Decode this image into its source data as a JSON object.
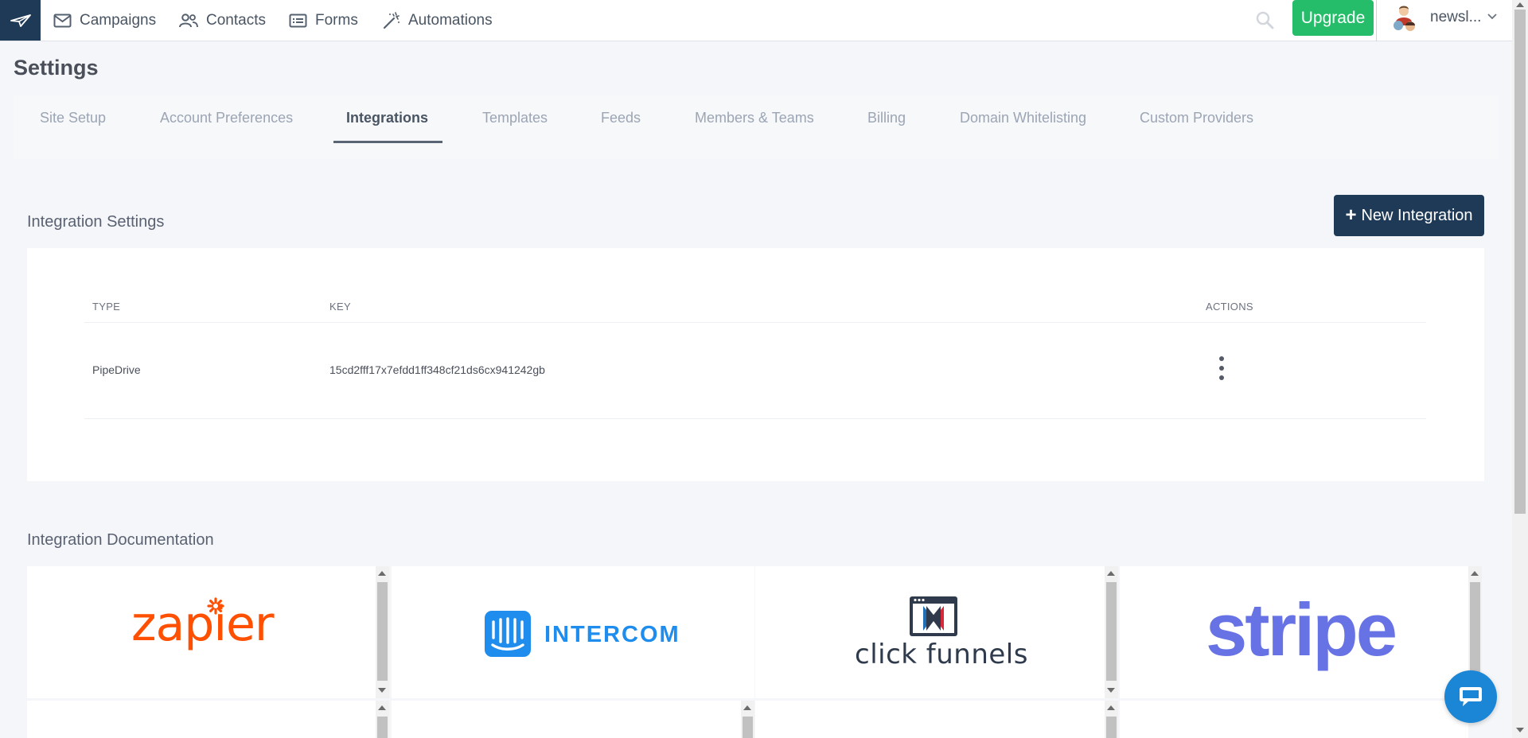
{
  "nav": {
    "items": [
      {
        "label": "Campaigns",
        "icon": "envelope-icon"
      },
      {
        "label": "Contacts",
        "icon": "users-icon"
      },
      {
        "label": "Forms",
        "icon": "form-icon"
      },
      {
        "label": "Automations",
        "icon": "magic-wand-icon"
      }
    ],
    "upgrade_label": "Upgrade",
    "user_name": "newsl...",
    "brand_icon": "paper-plane-icon"
  },
  "page": {
    "title": "Settings"
  },
  "tabs": [
    {
      "label": "Site Setup",
      "active": false
    },
    {
      "label": "Account Preferences",
      "active": false
    },
    {
      "label": "Integrations",
      "active": true
    },
    {
      "label": "Templates",
      "active": false
    },
    {
      "label": "Feeds",
      "active": false
    },
    {
      "label": "Members & Teams",
      "active": false
    },
    {
      "label": "Billing",
      "active": false
    },
    {
      "label": "Domain Whitelisting",
      "active": false
    },
    {
      "label": "Custom Providers",
      "active": false
    }
  ],
  "integration_settings": {
    "title": "Integration Settings",
    "new_button_label": "New Integration",
    "columns": {
      "type": "TYPE",
      "key": "KEY",
      "actions": "ACTIONS"
    },
    "rows": [
      {
        "type": "PipeDrive",
        "key": "15cd2fff17x7efdd1ff348cf21ds6cx941242gb"
      }
    ]
  },
  "integration_docs": {
    "title": "Integration Documentation",
    "providers": [
      {
        "name": "zapier",
        "logo_text": "zapier",
        "color": "#ff4f00"
      },
      {
        "name": "intercom",
        "logo_text": "INTERCOM",
        "color": "#1f8ded"
      },
      {
        "name": "clickfunnels",
        "logo_text": "click funnels",
        "color": "#2f3b4c"
      },
      {
        "name": "stripe",
        "logo_text": "stripe",
        "color": "#6772e5"
      }
    ]
  },
  "colors": {
    "brand_dark": "#1f3a57",
    "upgrade_green": "#26bd6a",
    "chat_blue": "#1b85d6"
  }
}
